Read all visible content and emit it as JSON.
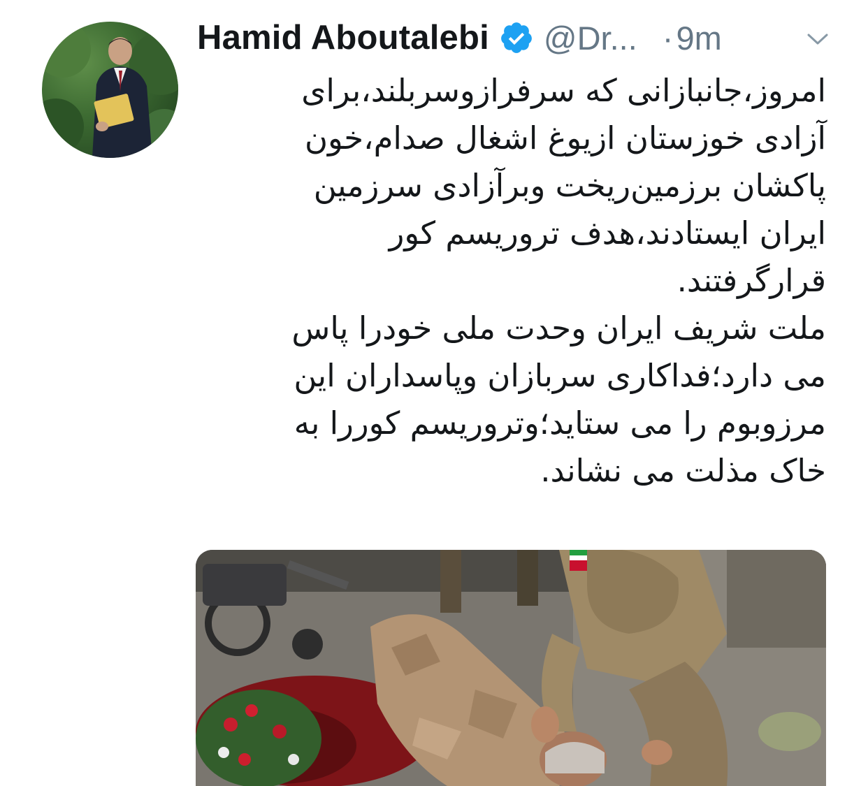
{
  "tweet": {
    "author_name": "Hamid Aboutalebi",
    "handle": "@Dr...",
    "separator": "·",
    "timestamp": "9m",
    "verified": true,
    "body_paragraph_1": "امروز،جانبازانی که سرفرازوسربلند،برای\nآزادی خوزستان ازیوغ اشغال صدام،خون\nپاکشان برزمین‌ریخت وبرآزادی سرزمین\nایران ایستادند،هدف تروریسم کور\nقرارگرفتند.",
    "body_paragraph_2": "ملت شریف ایران وحدت ملی خودرا پاس\nمی دارد؛فداکاری سربازان وپاسداران این\nمرزوبوم را می ستاید؛وتروریسم کوررا به\nخاک مذلت می نشاند."
  },
  "icons": {
    "verified": "verified-badge-icon",
    "more": "chevron-down-icon"
  },
  "colors": {
    "text_primary": "#14171a",
    "text_secondary": "#657786",
    "verified_blue": "#1da1f2"
  }
}
